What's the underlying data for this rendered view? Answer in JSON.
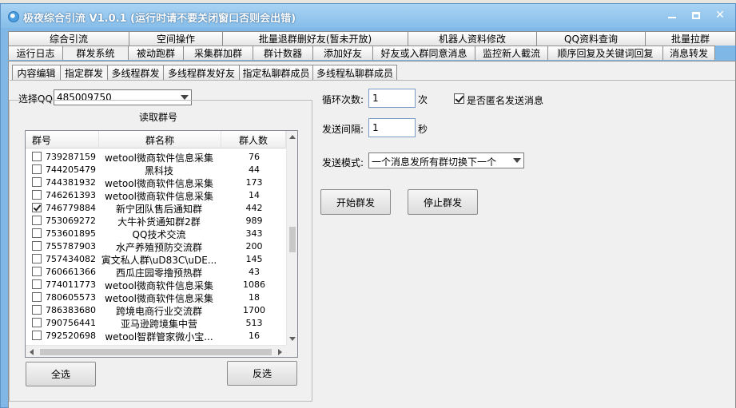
{
  "window": {
    "title": "极夜综合引流 V1.0.1 (运行时请不要关闭窗口否则会出错)"
  },
  "tabs_row1": [
    {
      "label": "综合引流"
    },
    {
      "label": "空间操作"
    },
    {
      "label": "批量退群删好友(暂未开放)"
    },
    {
      "label": "机器人资料修改"
    },
    {
      "label": "QQ资料查询"
    },
    {
      "label": "批量拉群"
    }
  ],
  "tabs_row2": [
    {
      "label": "运行日志"
    },
    {
      "label": "群发系统",
      "active": true
    },
    {
      "label": "被动跑群"
    },
    {
      "label": "采集群加群"
    },
    {
      "label": "群计数器"
    },
    {
      "label": "添加好友"
    },
    {
      "label": "好友或入群同意消息"
    },
    {
      "label": "监控新人截流"
    },
    {
      "label": "顺序回复及关键词回复"
    },
    {
      "label": "消息转发"
    }
  ],
  "subtabs": [
    {
      "label": "内容编辑"
    },
    {
      "label": "指定群发",
      "active": true
    },
    {
      "label": "多线程群发"
    },
    {
      "label": "多线程群发好友"
    },
    {
      "label": "指定私聊群成员"
    },
    {
      "label": "多线程私聊群成员"
    }
  ],
  "form": {
    "select_qq_label": "选择QQ:",
    "select_qq_value": "485009750",
    "groupbox_title": "读取群号",
    "loop_label": "循环次数:",
    "loop_value": "1",
    "loop_unit": "次",
    "interval_label": "发送间隔:",
    "interval_value": "1",
    "interval_unit": "秒",
    "anonymous_label": "是否匿名发送消息",
    "anonymous_checked": true,
    "mode_label": "发送模式:",
    "mode_value": "一个消息发所有群切换下一个"
  },
  "buttons": {
    "start": "开始群发",
    "stop": "停止群发",
    "select_all": "全选",
    "invert": "反选"
  },
  "groups_table": {
    "headers": [
      "群号",
      "群名称",
      "群人数"
    ],
    "rows": [
      {
        "id": "739287159",
        "name": "wetool微商软件信息采集",
        "count": "76",
        "checked": false
      },
      {
        "id": "744205479",
        "name": "黑科技",
        "count": "44",
        "checked": false
      },
      {
        "id": "744381932",
        "name": "wetool微商软件信息采集",
        "count": "173",
        "checked": false
      },
      {
        "id": "746261393",
        "name": "wetool微商软件信息采集",
        "count": "14",
        "checked": false
      },
      {
        "id": "746779884",
        "name": "新宁团队售后通知群",
        "count": "442",
        "checked": true
      },
      {
        "id": "753069272",
        "name": "大牛补货通知群2群",
        "count": "989",
        "checked": false
      },
      {
        "id": "753601895",
        "name": "QQ技术交流",
        "count": "343",
        "checked": false
      },
      {
        "id": "755787903",
        "name": "水产养殖预防交流群",
        "count": "200",
        "checked": false
      },
      {
        "id": "757434082",
        "name": "寅文私人群\\uD83C\\uDE...",
        "count": "145",
        "checked": false
      },
      {
        "id": "760661366",
        "name": "西瓜庄园零撸预热群",
        "count": "43",
        "checked": false
      },
      {
        "id": "774011773",
        "name": "wetool微商软件信息采集",
        "count": "1086",
        "checked": false
      },
      {
        "id": "780605573",
        "name": "wetool微商软件信息采集",
        "count": "18",
        "checked": false
      },
      {
        "id": "786383680",
        "name": "跨境电商行业交流群",
        "count": "1700",
        "checked": false
      },
      {
        "id": "790756441",
        "name": "亚马逊跨境集中营",
        "count": "513",
        "checked": false
      },
      {
        "id": "792520698",
        "name": "wetool智群管家微小宝...",
        "count": "16",
        "checked": false
      }
    ]
  },
  "colors": {
    "window_frame": "#7fb7e6",
    "panel_bg": "#f0f0f0"
  }
}
